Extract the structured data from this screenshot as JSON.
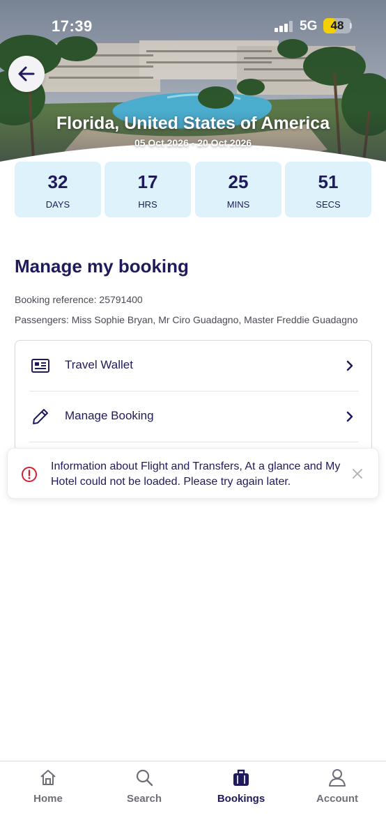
{
  "status_bar": {
    "time": "17:39",
    "network": "5G",
    "battery": "48",
    "battery_fraction": 0.48
  },
  "hero": {
    "destination": "Florida, United States of America",
    "dates": "05 Oct 2026 - 20 Oct 2026",
    "back_icon": "arrow-left-icon"
  },
  "countdown": [
    {
      "value": "32",
      "unit": "DAYS"
    },
    {
      "value": "17",
      "unit": "HRS"
    },
    {
      "value": "25",
      "unit": "MINS"
    },
    {
      "value": "51",
      "unit": "SECS"
    }
  ],
  "booking": {
    "title": "Manage my booking",
    "reference": "Booking reference: 25791400",
    "passengers": "Passengers: Miss Sophie Bryan, Mr Ciro Guadagno, Master Freddie Guadagno",
    "menu": [
      {
        "label": "Travel Wallet",
        "icon": "id-card-icon"
      },
      {
        "label": "Manage Booking",
        "icon": "pencil-icon"
      }
    ]
  },
  "toast": {
    "message": "Information about Flight and Transfers, At a glance and My Hotel could not be loaded. Please try again later.",
    "icon": "error-icon",
    "close_icon": "close-icon"
  },
  "tabbar": {
    "items": [
      {
        "label": "Home",
        "icon": "home-icon",
        "active": false
      },
      {
        "label": "Search",
        "icon": "search-icon",
        "active": false
      },
      {
        "label": "Bookings",
        "icon": "suitcase-icon",
        "active": true
      },
      {
        "label": "Account",
        "icon": "person-icon",
        "active": false
      }
    ]
  },
  "colors": {
    "brand_navy": "#1f1a5c",
    "countdown_bg": "#ddf2fb",
    "error_red": "#d32030",
    "battery_yellow": "#f5d000"
  }
}
